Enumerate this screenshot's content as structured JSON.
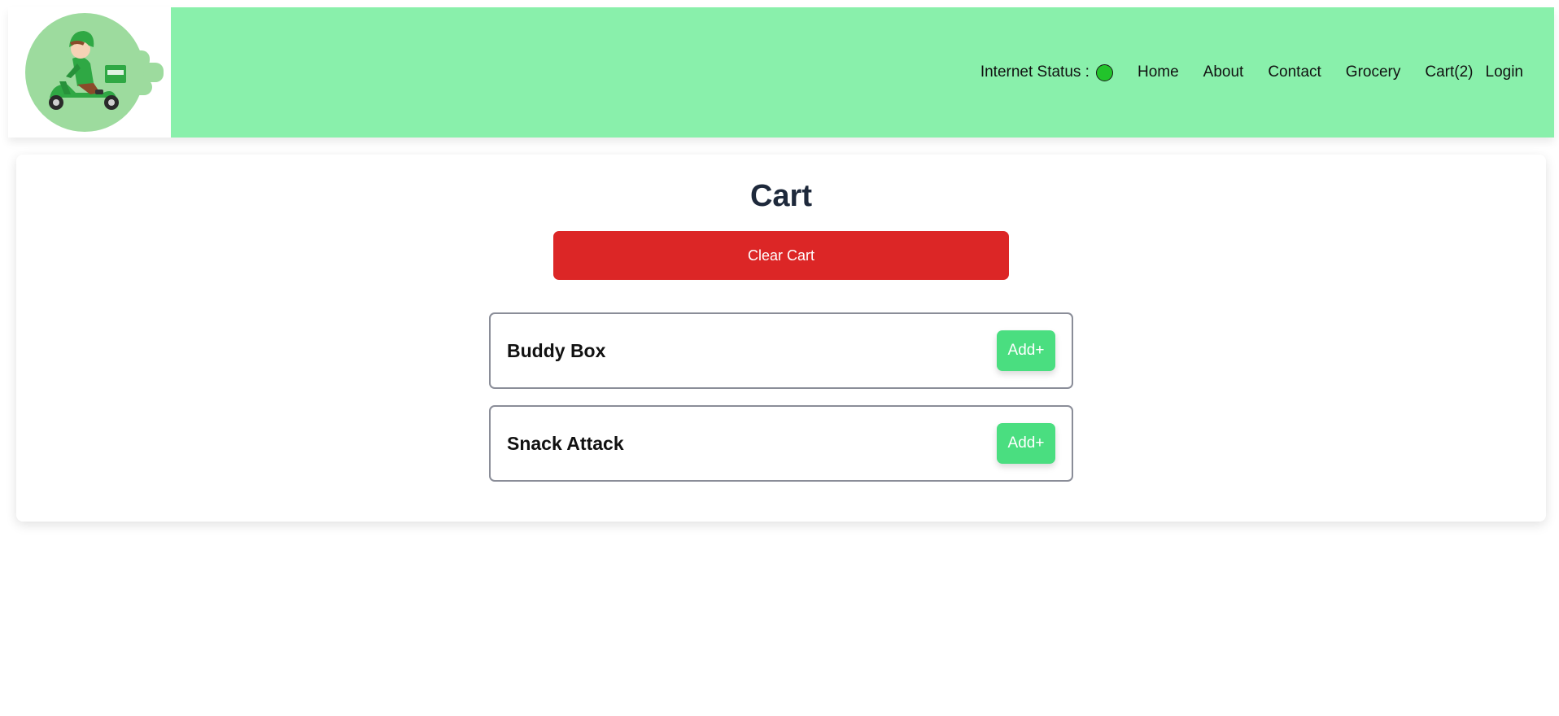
{
  "header": {
    "logo_icon": "delivery-scooter-logo",
    "nav": {
      "status_label": "Internet Status :",
      "status_color": "#22c32b",
      "home": "Home",
      "about": "About",
      "contact": "Contact",
      "grocery": "Grocery",
      "cart": "Cart(2)",
      "login": "Login"
    },
    "colors": {
      "nav_background": "#89f0ab",
      "logo_circle": "#9ddb9e"
    }
  },
  "main": {
    "title": "Cart",
    "clear_button": "Clear Cart",
    "clear_button_color": "#dc2626",
    "items": [
      {
        "name": "Buddy Box",
        "button": "Add+"
      },
      {
        "name": "Snack Attack",
        "button": "Add+"
      }
    ],
    "add_button_color": "#4ade80"
  }
}
